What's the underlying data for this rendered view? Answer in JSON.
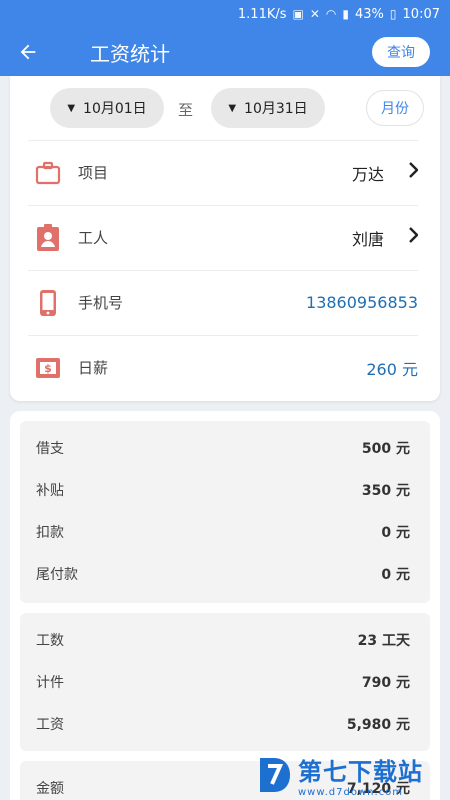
{
  "status_bar": {
    "speed": "1.11K/s",
    "battery": "43%",
    "time": "10:07"
  },
  "app_bar": {
    "title": "工资统计",
    "query_label": "查询"
  },
  "date_filter": {
    "start": "10月01日",
    "separator": "至",
    "end": "10月31日",
    "month_label": "月份"
  },
  "info": {
    "project": {
      "label": "项目",
      "value": "万达",
      "icon": "briefcase-icon"
    },
    "worker": {
      "label": "工人",
      "value": "刘唐",
      "icon": "badge-icon"
    },
    "phone": {
      "label": "手机号",
      "value": "13860956853",
      "icon": "phone-icon"
    },
    "daily_wage": {
      "label": "日薪",
      "value": "260 元",
      "icon": "money-icon"
    }
  },
  "group1": [
    {
      "label": "借支",
      "value": "500 元"
    },
    {
      "label": "补贴",
      "value": "350 元"
    },
    {
      "label": "扣款",
      "value": "0 元"
    },
    {
      "label": "尾付款",
      "value": "0 元"
    }
  ],
  "group2": [
    {
      "label": "工数",
      "value": "23 工天"
    },
    {
      "label": "计件",
      "value": "790 元"
    },
    {
      "label": "工资",
      "value": "5,980 元"
    }
  ],
  "group3": [
    {
      "label": "金额",
      "value": "7,120 元"
    }
  ],
  "watermark": {
    "main": "第七下载站",
    "sub": "www.d7down.com"
  },
  "colors": {
    "primary": "#3f86e8",
    "icon_red": "#e0706a",
    "value_blue": "#1e6fb5"
  }
}
